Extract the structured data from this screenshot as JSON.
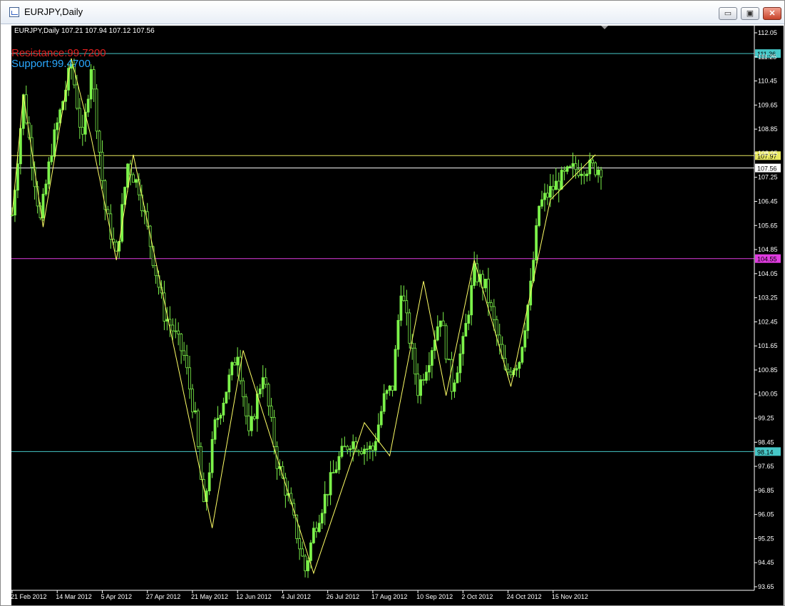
{
  "window": {
    "title": "EURJPY,Daily",
    "minimize_glyph": "▭",
    "maximize_glyph": "▣",
    "close_glyph": "✕"
  },
  "chart_info": {
    "header": "EURJPY,Daily  107.21 107.94 107.12 107.56",
    "resistance_label": "Resistance:99.7200",
    "support_label": "Support:99.4700"
  },
  "colors": {
    "background": "#000000",
    "candles": "#7cf24a",
    "zigzag": "#ffff66",
    "cyan_line": "#46c8c8",
    "yellow_line": "#e8e860",
    "gray_line": "#b0b0b0",
    "magenta_line": "#e03ce0",
    "resistance_text": "#e02020",
    "support_text": "#2aa8ff"
  },
  "chart_data": {
    "type": "line",
    "symbol": "EURJPY",
    "timeframe": "Daily",
    "ylim": [
      93.65,
      112.05
    ],
    "y_ticks": [
      112.05,
      111.25,
      110.45,
      109.65,
      108.85,
      108.05,
      107.25,
      106.45,
      105.65,
      104.85,
      104.05,
      103.25,
      102.45,
      101.65,
      100.85,
      100.05,
      99.25,
      98.45,
      97.65,
      96.85,
      96.05,
      95.25,
      94.45,
      93.65
    ],
    "x_tick_labels": [
      "21 Feb 2012",
      "14 Mar 2012",
      "5 Apr 2012",
      "27 Apr 2012",
      "21 May 2012",
      "12 Jun 2012",
      "4 Jul 2012",
      "26 Jul 2012",
      "17 Aug 2012",
      "10 Sep 2012",
      "2 Oct 2012",
      "24 Oct 2012",
      "15 Nov 2012"
    ],
    "x_tick_bar_index": [
      0,
      16,
      32,
      48,
      64,
      80,
      96,
      112,
      128,
      144,
      160,
      176,
      192
    ],
    "bars_total": 210,
    "price_series": {
      "bar_index": [
        0,
        4,
        10,
        14,
        21,
        25,
        28,
        33,
        37,
        41,
        45,
        48,
        51,
        54,
        57,
        61,
        65,
        68,
        72,
        75,
        80,
        84,
        89,
        94,
        98,
        104,
        107,
        112,
        116,
        120,
        124,
        128,
        132,
        135,
        138,
        141,
        144,
        148,
        152,
        156,
        160,
        164,
        168,
        171,
        175,
        180,
        184,
        187,
        191,
        195,
        199,
        203,
        207
      ],
      "close": [
        106.0,
        109.9,
        105.8,
        108.2,
        111.0,
        108.4,
        111.0,
        106.2,
        104.6,
        107.7,
        106.9,
        105.5,
        104.1,
        102.7,
        102.2,
        101.3,
        99.2,
        96.2,
        99.0,
        99.9,
        101.5,
        98.6,
        100.8,
        97.8,
        96.6,
        94.2,
        95.5,
        96.9,
        97.9,
        98.5,
        98.3,
        98.2,
        99.9,
        100.3,
        103.6,
        101.9,
        100.2,
        101.3,
        102.7,
        100.3,
        101.7,
        104.1,
        103.6,
        102.4,
        100.7,
        101.2,
        103.6,
        106.3,
        106.8,
        107.2,
        107.5,
        107.6,
        107.56
      ]
    },
    "zigzag": {
      "bar_index": [
        0,
        4,
        11,
        21,
        28,
        37,
        43,
        71,
        82,
        107,
        125,
        134,
        146,
        154,
        164,
        177,
        191,
        207
      ],
      "value": [
        106.0,
        110.0,
        105.6,
        111.2,
        108.6,
        104.5,
        108.0,
        95.6,
        101.5,
        94.1,
        99.1,
        98.0,
        103.8,
        100.0,
        104.5,
        100.3,
        106.5,
        108.0
      ]
    },
    "horizontal_levels": [
      {
        "price": 111.36,
        "label": "111.36",
        "color": "#46c8c8"
      },
      {
        "price": 107.97,
        "label": "107.97",
        "color": "#e8e860"
      },
      {
        "price": 107.56,
        "label": "107.56",
        "color": "#ffffff"
      },
      {
        "price": 104.55,
        "label": "104.55",
        "color": "#e03ce0"
      },
      {
        "price": 98.14,
        "label": "98.14",
        "color": "#46c8c8"
      }
    ]
  }
}
